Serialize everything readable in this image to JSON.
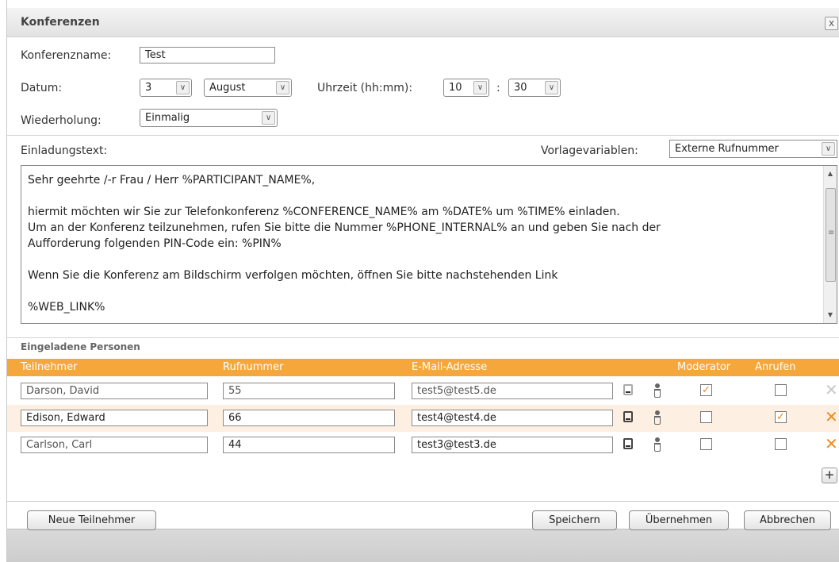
{
  "window": {
    "title": "Konferenzen",
    "close_label": "x"
  },
  "form": {
    "name_label": "Konferenzname:",
    "name_value": "Test",
    "date_label": "Datum:",
    "day_value": "3",
    "month_value": "August",
    "time_label": "Uhrzeit (hh:mm):",
    "hour_value": "10",
    "time_separator": ":",
    "minute_value": "30",
    "repeat_label": "Wiederholung:",
    "repeat_value": "Einmalig"
  },
  "invitation": {
    "label": "Einladungstext:",
    "template_label": "Vorlagevariablen:",
    "template_value": "Externe Rufnummer",
    "lines": [
      "Sehr geehrte /-r Frau / Herr %PARTICIPANT_NAME%,",
      "",
      "hiermit möchten wir Sie zur Telefonkonferenz %CONFERENCE_NAME% am %DATE% um %TIME% einladen.",
      "Um an der Konferenz teilzunehmen, rufen Sie bitte die Nummer %PHONE_INTERNAL% an und geben Sie nach der",
      "Aufforderung folgenden PIN-Code ein: %PIN%",
      "",
      "Wenn Sie die Konferenz am Bildschirm verfolgen möchten, öffnen Sie bitte nachstehenden Link",
      "",
      "%WEB_LINK%"
    ]
  },
  "participants": {
    "section_title": "Eingeladene Personen",
    "columns": {
      "name": "Teilnehmer",
      "phone": "Rufnummer",
      "email": "E-Mail-Adresse",
      "moderator": "Moderator",
      "call": "Anrufen"
    },
    "rows": [
      {
        "name": "Darson, David",
        "phone": "55",
        "email": "test5@test5.de",
        "moderator": "✓",
        "call": "",
        "active": false
      },
      {
        "name": "Edison, Edward",
        "phone": "66",
        "email": "test4@test4.de",
        "moderator": "",
        "call": "✓",
        "active": true
      },
      {
        "name": "Carlson, Carl",
        "phone": "44",
        "email": "test3@test3.de",
        "moderator": "",
        "call": "",
        "active": true
      }
    ],
    "add_label": "+",
    "delete_label": "✕"
  },
  "buttons": {
    "new_participant": "Neue Teilnehmer",
    "save": "Speichern",
    "apply": "Übernehmen",
    "cancel": "Abbrechen"
  },
  "colors": {
    "accent": "#f5a73b",
    "alt_row": "#fdf0e3",
    "delete_active": "#f08b1b"
  }
}
